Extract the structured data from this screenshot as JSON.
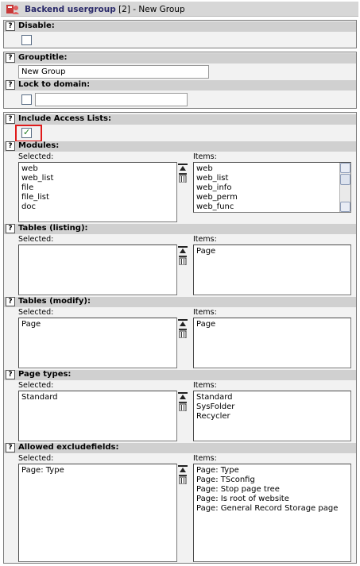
{
  "window": {
    "table_label": "Backend usergroup",
    "record_id": "[2]",
    "record_title": "- New Group"
  },
  "disable": {
    "label": "Disable:",
    "checked": false
  },
  "grouptitle": {
    "label": "Grouptitle:",
    "value": "New Group"
  },
  "lock_to_domain": {
    "label": "Lock to domain:",
    "checked": false,
    "value": ""
  },
  "include_access_lists": {
    "label": "Include Access Lists:",
    "checked": true
  },
  "modules": {
    "label": "Modules:",
    "selected_label": "Selected:",
    "items_label": "Items:",
    "selected": [
      "web",
      "web_list",
      "file",
      "file_list",
      "doc"
    ],
    "items": [
      "web",
      "web_list",
      "web_info",
      "web_perm",
      "web_func"
    ]
  },
  "tables_listing": {
    "label": "Tables (listing):",
    "selected_label": "Selected:",
    "items_label": "Items:",
    "selected": [],
    "items": [
      "Page"
    ]
  },
  "tables_modify": {
    "label": "Tables (modify):",
    "selected_label": "Selected:",
    "items_label": "Items:",
    "selected": [
      "Page"
    ],
    "items": [
      "Page"
    ]
  },
  "page_types": {
    "label": "Page types:",
    "selected_label": "Selected:",
    "items_label": "Items:",
    "selected": [
      "Standard"
    ],
    "items": [
      "Standard",
      "SysFolder",
      "Recycler"
    ]
  },
  "allowed_excludefields": {
    "label": "Allowed excludefields:",
    "selected_label": "Selected:",
    "items_label": "Items:",
    "selected": [
      "Page: Type"
    ],
    "items": [
      "Page: Type",
      "Page: TSconfig",
      "Page: Stop page tree",
      "Page: Is root of website",
      "Page: General Record Storage page"
    ]
  },
  "help_glyph": "?",
  "icons": {
    "help": "help-icon",
    "record": "backend-usergroup-icon",
    "move_up": "move-up-icon",
    "remove": "trash-icon",
    "scroll_up": "scroll-up-icon",
    "scroll_down": "scroll-down-icon",
    "check": "check-icon"
  },
  "colors": {
    "section_header": "#d0d0d0",
    "section_body": "#f2f2f2",
    "highlight": "#e01a1a",
    "check": "#1d7a1d"
  }
}
